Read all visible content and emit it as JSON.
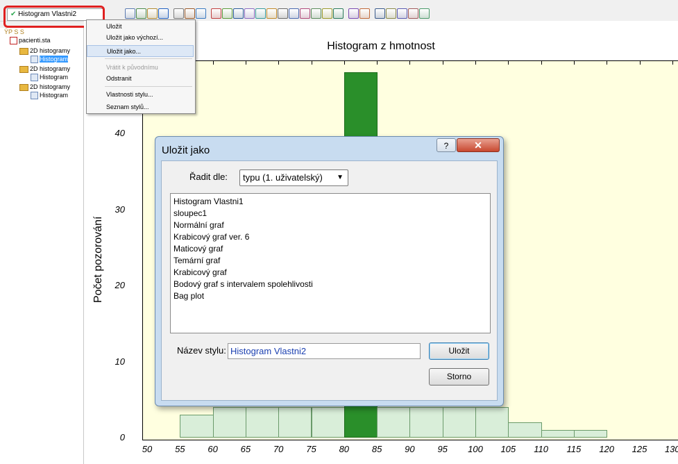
{
  "toolbar": {
    "style_combo_value": "Histogram Vlastni2"
  },
  "tree": {
    "root": "pacienti.sta",
    "items": [
      {
        "label": "2D histogramy"
      },
      {
        "label": "Histogram",
        "selected": true
      },
      {
        "label": "2D histogramy"
      },
      {
        "label": "Histogram"
      },
      {
        "label": "2D histogramy"
      },
      {
        "label": "Histogram"
      }
    ]
  },
  "context_menu": {
    "items": [
      {
        "label": "Uložit",
        "disabled": false
      },
      {
        "label": "Uložit jako výchozí...",
        "disabled": false
      },
      {
        "label": "Uložit jako...",
        "disabled": false,
        "highlighted": true
      },
      {
        "label": "Vrátit k původnímu",
        "disabled": true
      },
      {
        "label": "Odstranit",
        "disabled": false
      },
      {
        "label": "Vlastnosti stylu...",
        "disabled": false
      },
      {
        "label": "Seznam stylů...",
        "disabled": false
      }
    ]
  },
  "dialog": {
    "title": "Uložit jako",
    "help_glyph": "?",
    "close_glyph": "✕",
    "sort_label": "Řadit dle:",
    "sort_value": "typu (1. uživatelský)",
    "styles": [
      "Histogram Vlastni1",
      "sloupec1",
      "Normální graf",
      "Krabicový graf ver. 6",
      "Maticový graf",
      "Temární graf",
      "Krabicový graf",
      "Bodový graf s intervalem spolehlivosti",
      "Bag plot"
    ],
    "name_label": "Název stylu:",
    "name_value": "Histogram Vlastni2",
    "save_button": "Uložit",
    "cancel_button": "Storno"
  },
  "chart_data": {
    "type": "bar",
    "title": "Histogram z hmotnost",
    "ylabel": "Počet pozorování",
    "xlabel": "",
    "x_ticks": [
      "50",
      "55",
      "60",
      "65",
      "70",
      "75",
      "80",
      "85",
      "90",
      "95",
      "100",
      "105",
      "110",
      "115",
      "120",
      "125",
      "130"
    ],
    "y_ticks": [
      "0",
      "10",
      "20",
      "30",
      "40"
    ],
    "ylim": [
      0,
      50
    ],
    "bins": [
      {
        "from": 55,
        "to": 60,
        "value": 3
      },
      {
        "from": 60,
        "to": 65,
        "value": 4
      },
      {
        "from": 65,
        "to": 70,
        "value": 4
      },
      {
        "from": 70,
        "to": 75,
        "value": 4
      },
      {
        "from": 75,
        "to": 80,
        "value": 4
      },
      {
        "from": 80,
        "to": 85,
        "value": 48
      },
      {
        "from": 85,
        "to": 90,
        "value": 4
      },
      {
        "from": 90,
        "to": 95,
        "value": 4
      },
      {
        "from": 95,
        "to": 100,
        "value": 4
      },
      {
        "from": 100,
        "to": 105,
        "value": 4
      },
      {
        "from": 105,
        "to": 110,
        "value": 2
      },
      {
        "from": 110,
        "to": 115,
        "value": 1
      },
      {
        "from": 115,
        "to": 120,
        "value": 1
      }
    ],
    "highlight_color": "#2a8f2a",
    "bar_color": "#d9eed9",
    "plot_background": "#ffffe0"
  }
}
